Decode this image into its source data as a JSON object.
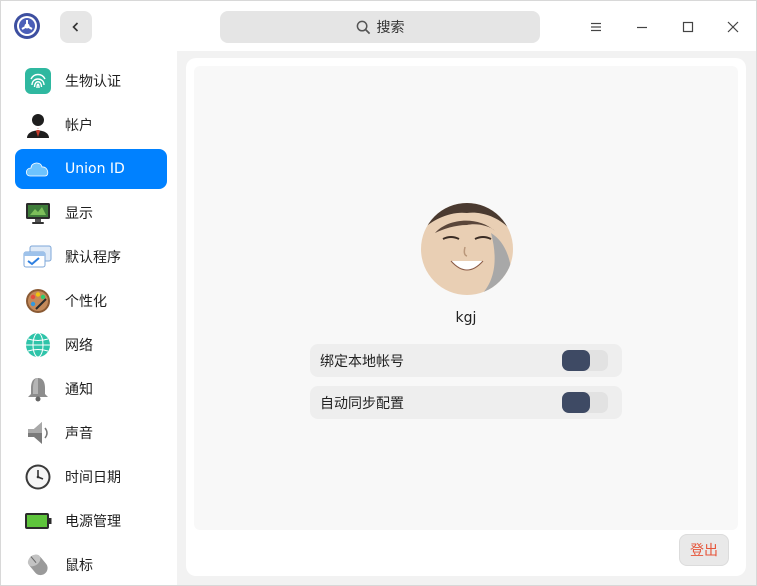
{
  "titlebar": {
    "search_placeholder": "搜索",
    "icons": {
      "app": "deepin-control-center-icon",
      "back": "chevron-left-icon",
      "search": "search-icon",
      "menu": "hamburger-menu-icon",
      "minimize": "minimize-icon",
      "maximize": "maximize-icon",
      "close": "close-icon"
    }
  },
  "sidebar": {
    "active_index": 2,
    "accent_color": "#0081ff",
    "items": [
      {
        "label": "生物认证",
        "icon": "fingerprint-icon"
      },
      {
        "label": "帐户",
        "icon": "account-icon"
      },
      {
        "label": "Union ID",
        "icon": "cloud-icon"
      },
      {
        "label": "显示",
        "icon": "display-icon"
      },
      {
        "label": "默认程序",
        "icon": "default-apps-icon"
      },
      {
        "label": "个性化",
        "icon": "palette-icon"
      },
      {
        "label": "网络",
        "icon": "network-globe-icon"
      },
      {
        "label": "通知",
        "icon": "bell-icon"
      },
      {
        "label": "声音",
        "icon": "speaker-icon"
      },
      {
        "label": "时间日期",
        "icon": "clock-icon"
      },
      {
        "label": "电源管理",
        "icon": "battery-icon"
      },
      {
        "label": "鼠标",
        "icon": "mouse-icon"
      }
    ]
  },
  "main": {
    "username": "kgj",
    "settings": [
      {
        "label": "绑定本地帐号",
        "enabled": false
      },
      {
        "label": "自动同步配置",
        "enabled": false
      }
    ],
    "logout_label": "登出",
    "logout_color": "#e6553a"
  }
}
